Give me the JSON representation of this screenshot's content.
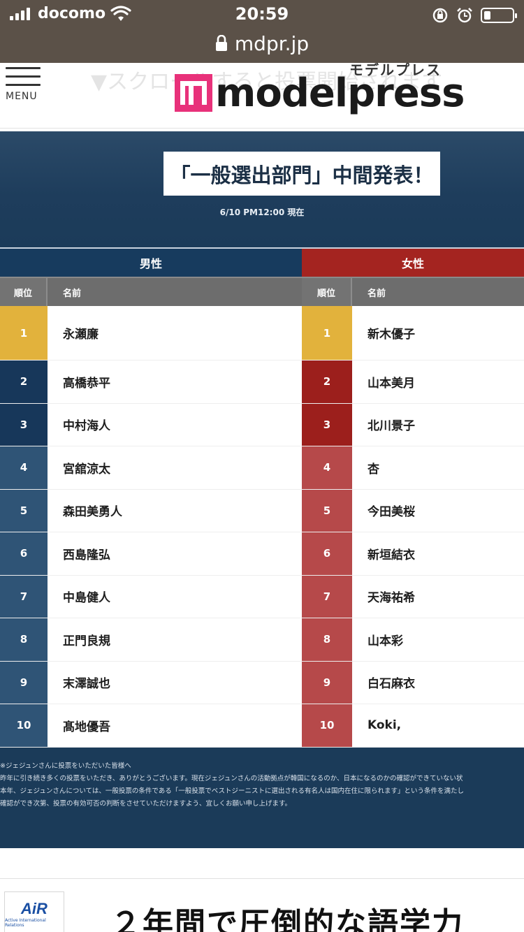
{
  "status_bar": {
    "carrier": "docomo",
    "time": "20:59",
    "url": "mdpr.jp"
  },
  "site_header": {
    "menu_label": "MENU",
    "logo_text": "modelpress",
    "logo_kana": "モデルプレス",
    "ghost_text": "▼スクロールすると投票開始されます"
  },
  "graphic": {
    "title": "「一般選出部門」中間発表！",
    "timestamp": "6/10 PM12:00 現在",
    "male": {
      "heading": "男性",
      "rank_header": "順位",
      "name_header": "名前",
      "rows": [
        {
          "rank": "1",
          "name": "永瀬廉"
        },
        {
          "rank": "2",
          "name": "高橋恭平"
        },
        {
          "rank": "3",
          "name": "中村海人"
        },
        {
          "rank": "4",
          "name": "宮舘涼太"
        },
        {
          "rank": "5",
          "name": "森田美勇人"
        },
        {
          "rank": "6",
          "name": "西島隆弘"
        },
        {
          "rank": "7",
          "name": "中島健人"
        },
        {
          "rank": "8",
          "name": "正門良規"
        },
        {
          "rank": "9",
          "name": "末澤誠也"
        },
        {
          "rank": "10",
          "name": "髙地優吾"
        }
      ]
    },
    "female": {
      "heading": "女性",
      "rank_header": "順位",
      "name_header": "名前",
      "rows": [
        {
          "rank": "1",
          "name": "新木優子"
        },
        {
          "rank": "2",
          "name": "山本美月"
        },
        {
          "rank": "3",
          "name": "北川景子"
        },
        {
          "rank": "4",
          "name": "杏"
        },
        {
          "rank": "5",
          "name": "今田美桜"
        },
        {
          "rank": "6",
          "name": "新垣結衣"
        },
        {
          "rank": "7",
          "name": "天海祐希"
        },
        {
          "rank": "8",
          "name": "山本彩"
        },
        {
          "rank": "9",
          "name": "白石麻衣"
        },
        {
          "rank": "10",
          "name": "Koki,"
        }
      ]
    },
    "notes": [
      "※ジェジュンさんに投票をいただいた皆様へ",
      "昨年に引き続き多くの投票をいただき、ありがとうございます。現在ジェジュンさんの活動拠点が韓国になるのか、日本になるのかの確認ができていない状",
      "本年、ジェジュンさんについては、一般投票の条件である「一般投票でベストジーニストに選出される有名人は国内在住に限られます」という条件を満たし",
      "確認ができ次第、投票の有効可否の判断をさせていただけますよう、宜しくお願い申し上げます。"
    ]
  },
  "ad": {
    "logo_text": "AiR",
    "logo_sub": "Active International Relations",
    "headline": "２年間で圧倒的な語学力"
  },
  "colors": {
    "gold": "#e2b23c",
    "male_top": "#17375a",
    "male_rest": "#2f5476",
    "female_top": "#9c1f1c",
    "female_rest": "#b6494a"
  }
}
